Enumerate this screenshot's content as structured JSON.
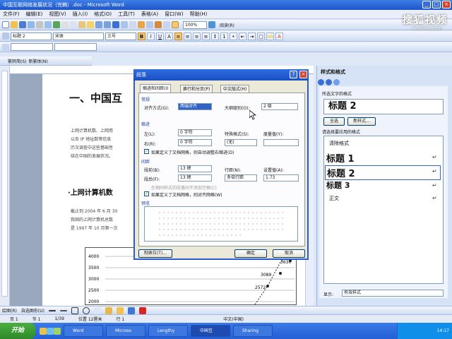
{
  "window": {
    "title": "中国互联网络发展状况（完稿）.doc - Microsoft Word"
  },
  "menubar": [
    "文件(F)",
    "编辑(E)",
    "视图(V)",
    "插入(I)",
    "格式(O)",
    "工具(T)",
    "表格(A)",
    "窗口(W)",
    "帮助(H)"
  ],
  "toolbar": {
    "zoom": "100%",
    "read_label": "阅读(R)"
  },
  "format_toolbar": {
    "style": "标题 2",
    "font": "宋体",
    "size": "三号"
  },
  "extra_toolbar": {
    "left": "繁转简(S)",
    "right": "新繁体(N)"
  },
  "watermark": {
    "brand": "搜狐视频",
    "url": "tv.sohu.com"
  },
  "document": {
    "heading1": "一、中国互",
    "para1": [
      "上网计算机数、上网用",
      "以及 IP 地址数等信息",
      "历次调查中这些基础性",
      "结在中国的发展状况。"
    ],
    "heading2": "·上网计算机数",
    "para2": [
      "截止到 2004 年 6 月 30",
      "我国的上网计算机总数",
      "是 1997 年 10 月第一次"
    ],
    "chart_yticks": [
      "4000",
      "3500",
      "3000",
      "2500",
      "2000"
    ],
    "chart_labels": [
      "3630",
      "3089",
      "2572"
    ]
  },
  "dialog": {
    "title": "段落",
    "tabs": [
      "缩进和间距(I)",
      "换行和分页(P)",
      "中文版式(H)"
    ],
    "general_group": "常规",
    "align_label": "对齐方式(G):",
    "align_value": "两端对齐",
    "outline_label": "大纲级别(O):",
    "outline_value": "2 级",
    "indent_group": "缩进",
    "left_label": "左(L):",
    "left_value": "0 字符",
    "right_label": "右(R):",
    "right_value": "0 字符",
    "special_label": "特殊格式(S):",
    "special_value": "(无)",
    "by_label": "度量值(Y):",
    "check1": "如果定义了文档网格，则自动调整右缩进(D)",
    "spacing_group": "间距",
    "before_label": "段前(B):",
    "before_value": "13 磅",
    "after_label": "段后(F):",
    "after_value": "13 磅",
    "line_label": "行距(N):",
    "line_value": "多倍行距",
    "at_label": "设置值(A):",
    "at_value": "1.73",
    "check_disabled": "在相同样式的段落间不添加空格(C)",
    "check2": "如果定义了文档网格，则对齐网格(W)",
    "preview_group": "预览",
    "btn_tabs": "制表位(T)...",
    "btn_ok": "确定",
    "btn_cancel": "取消"
  },
  "styles_pane": {
    "title": "样式和格式",
    "selected_label": "所选文字的格式",
    "selected_value": "标题 2",
    "btn_select_all": "全选",
    "btn_new": "新样式...",
    "apply_label": "请选择要应用的格式",
    "items": [
      "清除格式",
      "标题 1",
      "标题 2",
      "标题 3",
      "正文"
    ],
    "show_label": "显示:",
    "show_value": "有效样式"
  },
  "drawbar": {
    "draw": "绘图(R)",
    "autoshape": "自选图形(U)"
  },
  "status": {
    "page": "页 1",
    "section": "节 1",
    "pages": "1/39",
    "position": "位置 12厘米",
    "line": "行 1",
    "lang": "中文(中国)"
  },
  "taskbar": {
    "start": "开始",
    "tasks": [
      "Word",
      "Microso",
      "Lengthy",
      "中国互",
      "Sharing"
    ],
    "clock": "14:17"
  }
}
